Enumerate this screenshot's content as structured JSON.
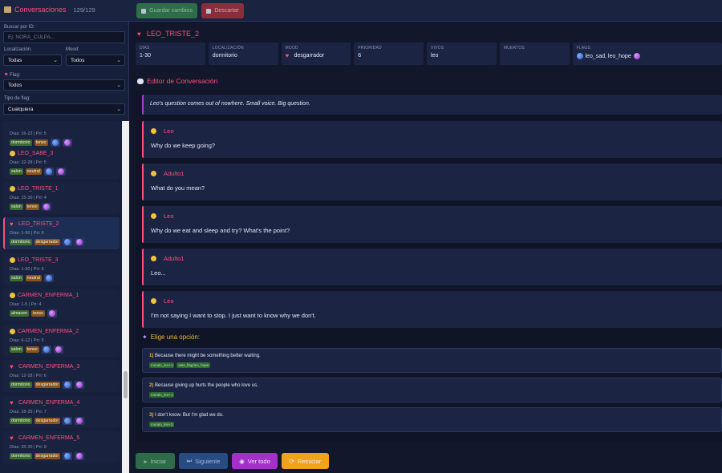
{
  "topbar": {
    "title": "Conversaciones",
    "count": "129/129",
    "save_label": "Guardar cambios",
    "discard_label": "Descartar"
  },
  "filters": {
    "search_label": "Buscar por ID:",
    "search_placeholder": "Ej: NORA_CULPA...",
    "location_label": "Localización:",
    "location_value": "Todas",
    "mood_label": "Mood:",
    "mood_value": "Todos",
    "flag_label": "Flag:",
    "flag_value": "Todos",
    "flag_type_label": "Tipo de flag:",
    "flag_type_value": "Cualquiera"
  },
  "list": [
    {
      "name": "",
      "icon": "none",
      "meta": "Días: 16-22 | Pri: 5",
      "loc": "dormitorio",
      "mood": "tenso",
      "dots": [
        "blue",
        "purple"
      ]
    },
    {
      "name": "LEO_SABE_3",
      "icon": "face",
      "meta": "Días: 22-28 | Pri: 5",
      "loc": "salon",
      "mood": "neutral",
      "dots": [
        "blue",
        "purple"
      ]
    },
    {
      "name": "LEO_TRISTE_1",
      "icon": "face",
      "meta": "Días: 15-30 | Pri: 4",
      "loc": "salon",
      "mood": "tenso",
      "dots": [
        "purple"
      ]
    },
    {
      "name": "LEO_TRISTE_2",
      "icon": "heart",
      "meta": "Días: 1-30 | Pri: 6",
      "loc": "dormitorio",
      "mood": "desgarrador",
      "dots": [
        "blue",
        "purple"
      ],
      "selected": true
    },
    {
      "name": "LEO_TRISTE_3",
      "icon": "face",
      "meta": "Días: 1-30 | Pri: 5",
      "loc": "salon",
      "mood": "neutral",
      "dots": [
        "blue"
      ]
    },
    {
      "name": "CARMEN_ENFERMA_1",
      "icon": "face",
      "meta": "Días: 1-5 | Pri: 4",
      "loc": "almacen",
      "mood": "tenso",
      "dots": [
        "purple"
      ]
    },
    {
      "name": "CARMEN_ENFERMA_2",
      "icon": "face",
      "meta": "Días: 6-12 | Pri: 5",
      "loc": "salon",
      "mood": "tenso",
      "dots": [
        "blue",
        "purple"
      ]
    },
    {
      "name": "CARMEN_ENFERMA_3",
      "icon": "heart",
      "meta": "Días: 12-18 | Pri: 6",
      "loc": "dormitorio",
      "mood": "desgarrador",
      "dots": [
        "blue",
        "purple"
      ]
    },
    {
      "name": "CARMEN_ENFERMA_4",
      "icon": "heart",
      "meta": "Días: 18-25 | Pri: 7",
      "loc": "dormitorio",
      "mood": "desgarrador",
      "dots": [
        "blue",
        "purple"
      ]
    },
    {
      "name": "CARMEN_ENFERMA_5",
      "icon": "heart",
      "meta": "Días: 25-30 | Pri: 9",
      "loc": "dormitorio",
      "mood": "desgarrador",
      "dots": [
        "blue",
        "purple"
      ]
    }
  ],
  "detail": {
    "title": "LEO_TRISTE_2",
    "fields": [
      {
        "key": "DÍAS",
        "value": "1-30"
      },
      {
        "key": "LOCALIZACIÓN",
        "value": "dormitorio"
      },
      {
        "key": "MOOD",
        "value": "desgarrador"
      },
      {
        "key": "PRIORIDAD",
        "value": "6"
      },
      {
        "key": "VIVOS",
        "value": "leo"
      },
      {
        "key": "MUERTOS",
        "value": ""
      },
      {
        "key": "FLAGS",
        "value": "leo_sad, leo_hope"
      }
    ],
    "editor_title": "Editor de Conversación",
    "narration": "Leo's question comes out of nowhere. Small voice. Big question.",
    "messages": [
      {
        "speaker": "Leo",
        "text": "Why do we keep going?"
      },
      {
        "speaker": "Adulto1",
        "text": "What do you mean?"
      },
      {
        "speaker": "Leo",
        "text": "Why do we eat and sleep and try? What's the point?"
      },
      {
        "speaker": "Adulto1",
        "text": "Leo..."
      },
      {
        "speaker": "Leo",
        "text": "I'm not saying I want to stop. I just want to know why we don't."
      }
    ],
    "choose_label": "Elige una opción:",
    "options": [
      {
        "num": "1)",
        "text": "Because there might be something better waiting.",
        "chips": [
          "moralo_leo+1",
          "sets_flag:leo_hope"
        ]
      },
      {
        "num": "2)",
        "text": "Because giving up hurts the people who love us.",
        "chips": [
          "moralo_leo+1"
        ]
      },
      {
        "num": "3)",
        "text": "I don't know. But I'm glad we do.",
        "chips": [
          "moralo_leo+2"
        ]
      }
    ]
  },
  "footer": {
    "start_label": "Iniciar",
    "next_label": "Siguiente",
    "view_all_label": "Ver todo",
    "reset_label": "Reiniciar"
  }
}
